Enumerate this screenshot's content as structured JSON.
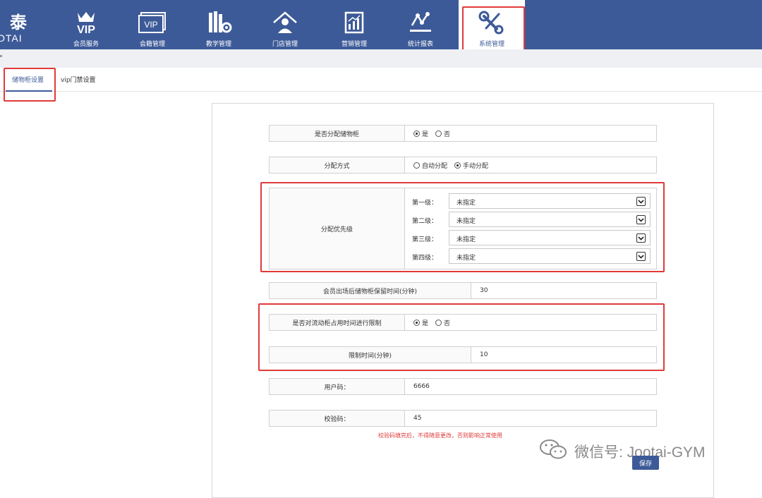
{
  "brand": {
    "mark": "泰",
    "word": "OTAI"
  },
  "nav": [
    {
      "label": "会员服务",
      "icon": "vip-crown-icon"
    },
    {
      "label": "会籍管理",
      "icon": "vip-card-icon"
    },
    {
      "label": "教学管理",
      "icon": "books-gear-icon"
    },
    {
      "label": "门店管理",
      "icon": "store-manager-icon"
    },
    {
      "label": "营销管理",
      "icon": "marketing-chart-icon"
    },
    {
      "label": "统计报表",
      "icon": "statistics-icon"
    },
    {
      "label": "系统管理",
      "icon": "system-tools-icon",
      "active": true
    }
  ],
  "tabs": {
    "locker": "储物柜设置",
    "vip_gate": "vip门禁设置"
  },
  "form": {
    "assign_locker": {
      "label": "是否分配储物柜",
      "yes": "是",
      "no": "否",
      "selected": "yes"
    },
    "assign_mode": {
      "label": "分配方式",
      "auto": "自动分配",
      "manual": "手动分配",
      "selected": "manual"
    },
    "priority": {
      "label": "分配优先级",
      "levels": [
        {
          "label": "第一级：",
          "value": "未指定"
        },
        {
          "label": "第二级：",
          "value": "未指定"
        },
        {
          "label": "第三级：",
          "value": "未指定"
        },
        {
          "label": "第四级：",
          "value": "未指定"
        }
      ]
    },
    "retain_time": {
      "label": "会员出场后储物柜保留时间(分钟)",
      "value": "30"
    },
    "limit_floating": {
      "label": "是否对流动柜占用时间进行限制",
      "yes": "是",
      "no": "否",
      "selected": "yes"
    },
    "limit_time": {
      "label": "限制时间(分钟)",
      "value": "10"
    },
    "user_code": {
      "label": "用户码：",
      "value": "6666"
    },
    "verify_code": {
      "label": "校验码：",
      "value": "45"
    },
    "hint": "校验码填完后，不得随意更改，否则影响正常使用",
    "save": "保存"
  },
  "watermark": "微信号: Jootai-GYM",
  "colors": {
    "nav_bg": "#3d5a98",
    "highlight": "#e03a3a"
  }
}
